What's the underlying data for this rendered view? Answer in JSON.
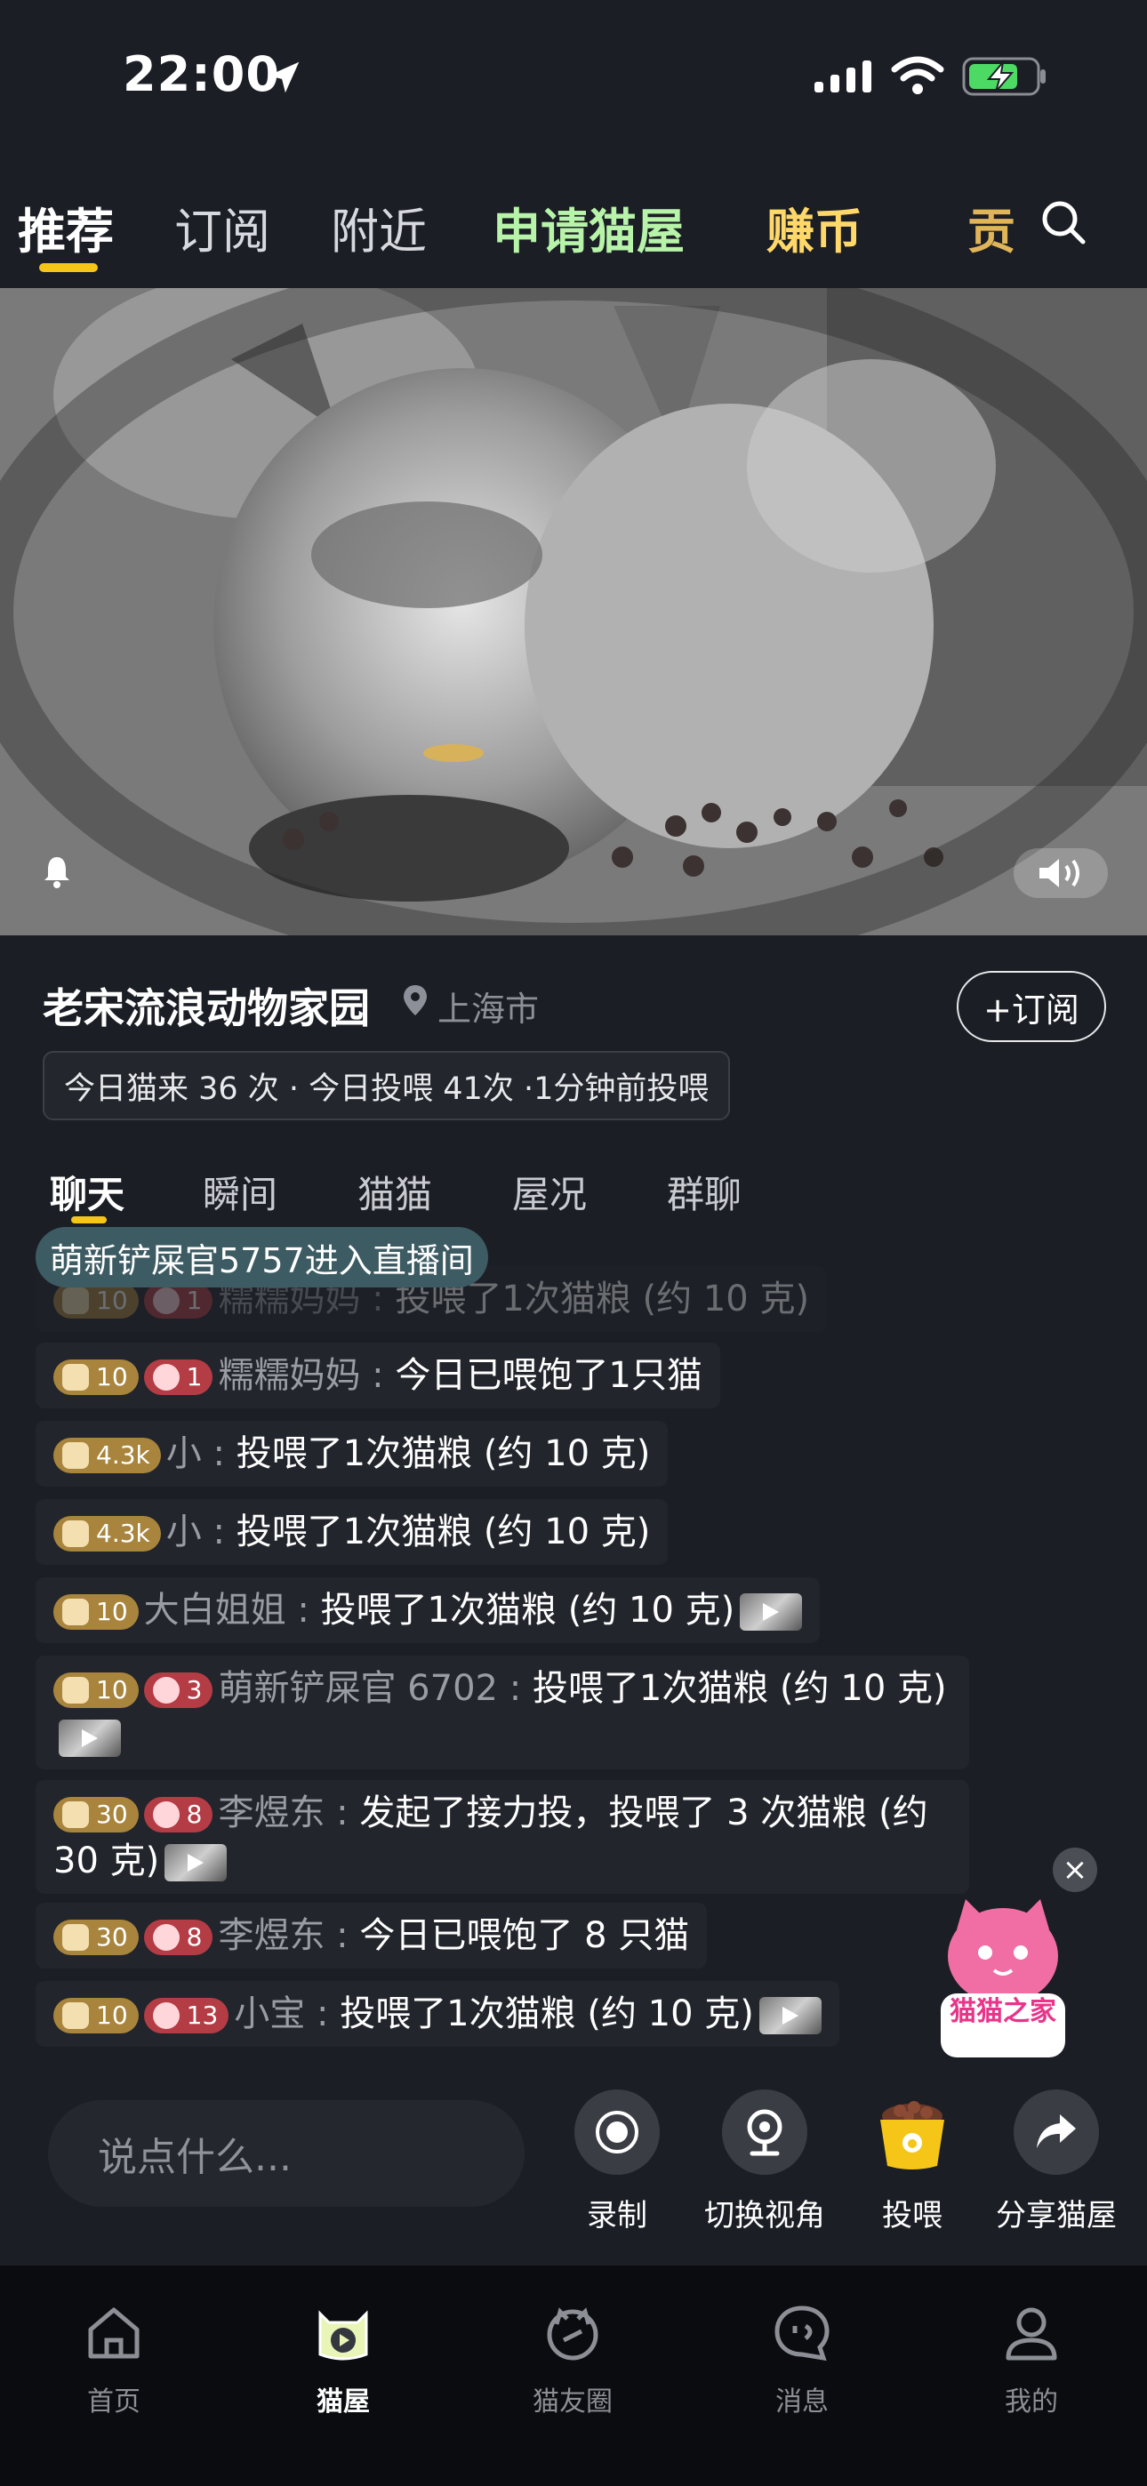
{
  "status_bar": {
    "time": "22:00",
    "icons": [
      "location-arrow-icon",
      "signal-icon",
      "wifi-icon",
      "battery-charging-icon"
    ]
  },
  "top_tabs": [
    {
      "label": "推荐",
      "active": true
    },
    {
      "label": "订阅"
    },
    {
      "label": "附近"
    },
    {
      "label": "申请猫屋"
    },
    {
      "label": "赚币"
    },
    {
      "label": "贡"
    }
  ],
  "room": {
    "name": "老宋流浪动物家园",
    "location": "上海市",
    "subscribe_label": "+订阅",
    "stats": "今日猫来 36 次 · 今日投喂 41次 ·1分钟前投喂"
  },
  "chat_tabs": [
    "聊天",
    "瞬间",
    "猫猫",
    "屋况",
    "群聊"
  ],
  "enter_notice": "萌新铲屎官5757进入直播间",
  "messages": [
    {
      "food": "10",
      "cats": "1",
      "user": "糯糯妈妈",
      "text": "投喂了1次猫粮 (约 10 克)",
      "faded": true,
      "video": false
    },
    {
      "food": "10",
      "cats": "1",
      "user": "糯糯妈妈",
      "text": "今日已喂饱了1只猫",
      "video": false
    },
    {
      "food": "4.3k",
      "cats": "",
      "user": "小",
      "text": "投喂了1次猫粮 (约 10 克)",
      "video": false
    },
    {
      "food": "4.3k",
      "cats": "",
      "user": "小",
      "text": "投喂了1次猫粮 (约 10 克)",
      "video": false
    },
    {
      "food": "10",
      "cats": "",
      "user": "大白姐姐",
      "text": "投喂了1次猫粮 (约 10 克)",
      "video": true
    },
    {
      "food": "10",
      "cats": "3",
      "user": "萌新铲屎官 6702",
      "text": "投喂了1次猫粮 (约 10 克)",
      "video": true
    },
    {
      "food": "30",
      "cats": "8",
      "user": "李煜东",
      "text": "发起了接力投，投喂了 3 次猫粮 (约 30 克)",
      "video": true
    },
    {
      "food": "30",
      "cats": "8",
      "user": "李煜东",
      "text": "今日已喂饱了 8 只猫",
      "video": false
    },
    {
      "food": "10",
      "cats": "13",
      "user": "小宝",
      "text": "投喂了1次猫粮 (约 10 克)",
      "video": true
    }
  ],
  "mascot_text": "猫猫之家",
  "input_placeholder": "说点什么...",
  "actions": [
    {
      "label": "录制",
      "icon": "record-icon"
    },
    {
      "label": "切换视角",
      "icon": "camera-switch-icon"
    },
    {
      "label": "投喂",
      "icon": "food-bowl-icon"
    },
    {
      "label": "分享猫屋",
      "icon": "share-arrow-icon"
    }
  ],
  "bottom_nav": [
    {
      "label": "首页",
      "icon": "home-icon"
    },
    {
      "label": "猫屋",
      "icon": "cat-house-play-icon",
      "active": true
    },
    {
      "label": "猫友圈",
      "icon": "cat-circle-icon"
    },
    {
      "label": "消息",
      "icon": "message-icon"
    },
    {
      "label": "我的",
      "icon": "profile-icon"
    }
  ],
  "colors": {
    "accent": "#f5c518",
    "green_tab": "#b7f3a8",
    "gold_tab": "#ffd86a",
    "background": "#1b1e25"
  }
}
